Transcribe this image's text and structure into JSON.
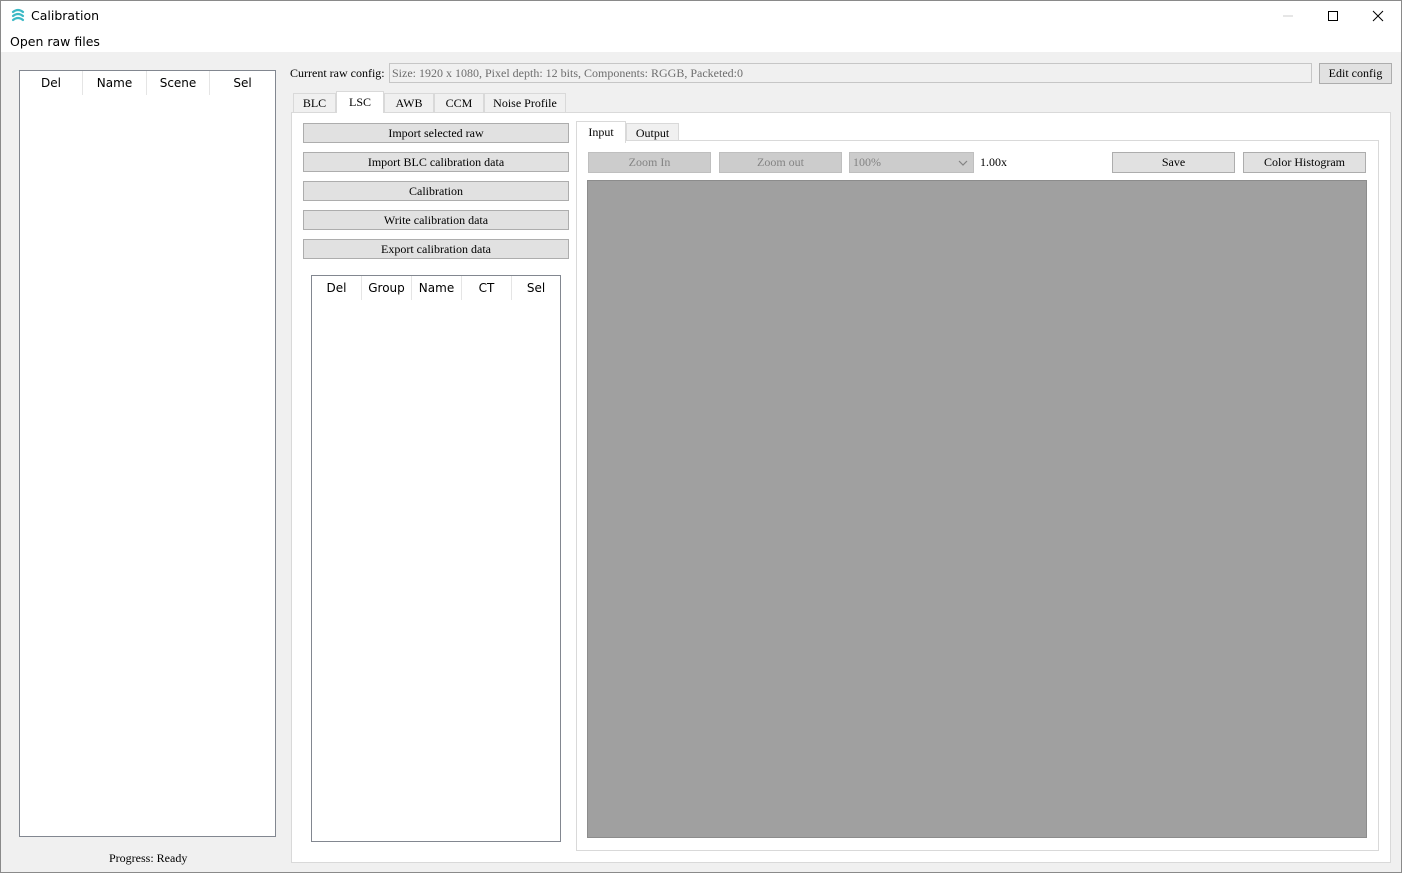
{
  "window": {
    "title": "Calibration",
    "controls": {
      "minimize": "—",
      "maximize": "☐",
      "close": "✕"
    }
  },
  "menu": {
    "open_raw_files": "Open raw files"
  },
  "left_table": {
    "columns": [
      "Del",
      "Name",
      "Scene",
      "Sel"
    ]
  },
  "progress": {
    "text": "Progress: Ready"
  },
  "raw_config": {
    "label": "Current raw config:",
    "value": "Size: 1920 x 1080, Pixel depth: 12 bits, Components: RGGB, Packeted:0",
    "edit_button": "Edit config"
  },
  "tabs": [
    {
      "label": "BLC",
      "active": false
    },
    {
      "label": "LSC",
      "active": true
    },
    {
      "label": "AWB",
      "active": false
    },
    {
      "label": "CCM",
      "active": false
    },
    {
      "label": "Noise Profile",
      "active": false
    }
  ],
  "lsc": {
    "buttons": [
      "Import selected raw",
      "Import BLC calibration data",
      "Calibration",
      "Write calibration data",
      "Export calibration data"
    ],
    "table_columns": [
      "Del",
      "Group",
      "Name",
      "CT",
      "Sel"
    ]
  },
  "view": {
    "tabs": [
      {
        "label": "Input",
        "active": true
      },
      {
        "label": "Output",
        "active": false
      }
    ],
    "zoom_in": "Zoom In",
    "zoom_out": "Zoom out",
    "zoom_select": "100%",
    "zoom_factor": "1.00x",
    "save": "Save",
    "color_histogram": "Color Histogram"
  },
  "colors": {
    "canvas": "#a0a0a0",
    "accent": "#3bb9c5"
  }
}
